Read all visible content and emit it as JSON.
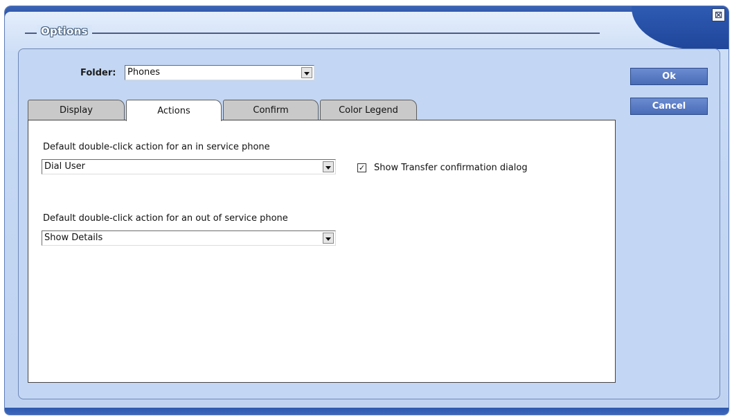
{
  "window": {
    "title": "Options",
    "close_glyph": "⊠"
  },
  "folder": {
    "label": "Folder:",
    "value": "Phones"
  },
  "buttons": {
    "ok": "Ok",
    "cancel": "Cancel"
  },
  "tabs": [
    {
      "label": "Display",
      "active": false
    },
    {
      "label": "Actions",
      "active": true
    },
    {
      "label": "Confirm",
      "active": false
    },
    {
      "label": "Color Legend",
      "active": false
    }
  ],
  "actions": {
    "in_service_label": "Default double-click action for an in service phone",
    "in_service_value": "Dial User",
    "out_of_service_label": "Default double-click action for an out of service phone",
    "out_of_service_value": "Show Details",
    "transfer_checkbox_label": "Show Transfer confirmation dialog",
    "transfer_checkbox_checked": true,
    "check_glyph": "✓"
  },
  "colors": {
    "accent": "#2a4f9e",
    "panel": "#c3d6f3"
  }
}
